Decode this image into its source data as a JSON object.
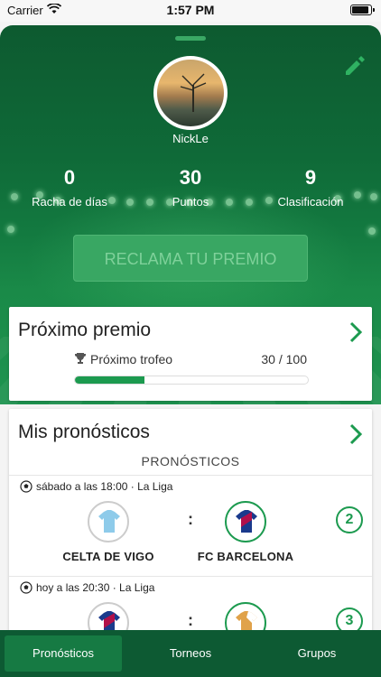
{
  "status_bar": {
    "carrier": "Carrier",
    "time": "1:57 PM"
  },
  "profile": {
    "username": "NickLe"
  },
  "stats": [
    {
      "value": "0",
      "label": "Racha de días"
    },
    {
      "value": "30",
      "label": "Puntos"
    },
    {
      "value": "9",
      "label": "Clasificación"
    }
  ],
  "claim_button": "RECLAMA TU PREMIO",
  "next_prize": {
    "title": "Próximo premio",
    "trophy_label": "Próximo trofeo",
    "progress_text": "30 / 100",
    "progress_fraction": 0.3
  },
  "predictions": {
    "title": "Mis pronósticos",
    "subheader": "PRONÓSTICOS",
    "matches": [
      {
        "when": "sábado a las 18:00 · La Liga",
        "home": "CELTA DE VIGO",
        "away": "FC BARCELONA",
        "separator": ":",
        "points": "2"
      },
      {
        "when": "hoy a las 20:30 · La Liga",
        "home": "",
        "away": "",
        "separator": ":",
        "points": "3"
      }
    ]
  },
  "tabs": [
    {
      "label": "Pronósticos",
      "active": true
    },
    {
      "label": "Torneos",
      "active": false
    },
    {
      "label": "Grupos",
      "active": false
    }
  ],
  "colors": {
    "brand_green": "#1c9a4f",
    "dark_green": "#0d5a33"
  }
}
